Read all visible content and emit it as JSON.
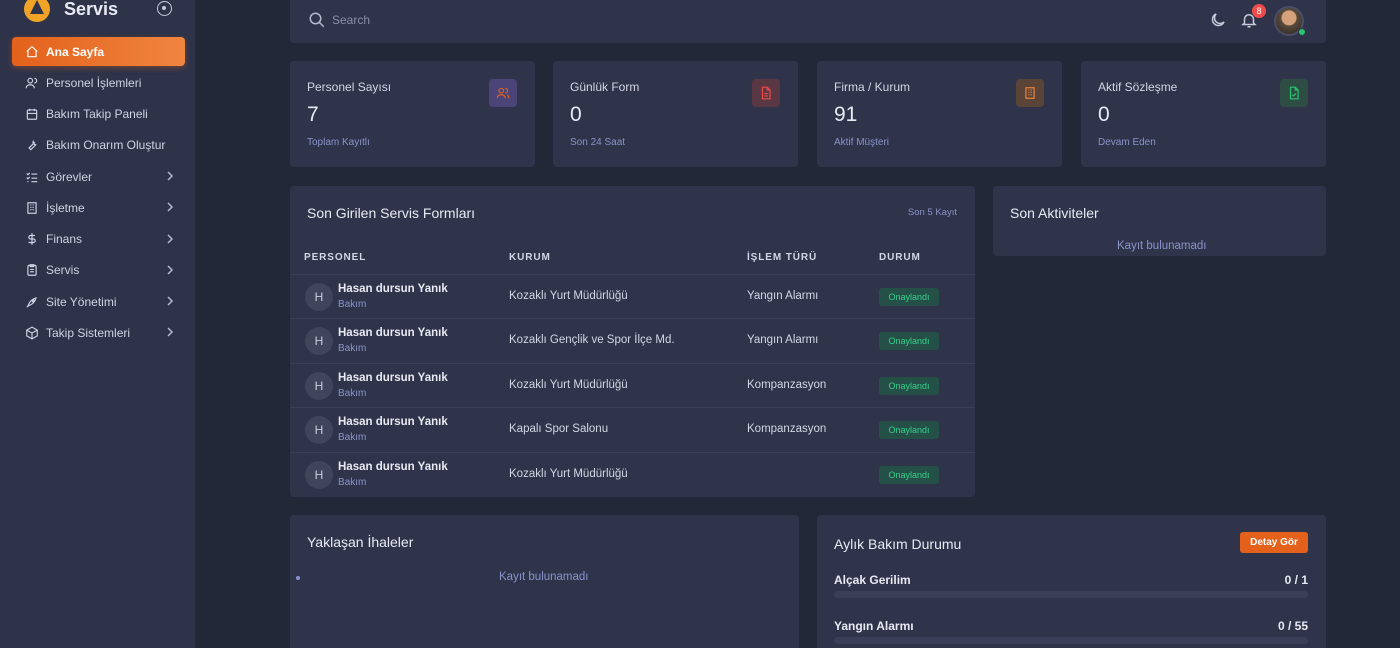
{
  "brand": {
    "name": "Servis"
  },
  "sidebar": {
    "items": [
      {
        "label": "Ana Sayfa",
        "icon": "home-icon",
        "active": true,
        "chevron": false
      },
      {
        "label": "Personel İşlemleri",
        "icon": "users-icon",
        "active": false,
        "chevron": false
      },
      {
        "label": "Bakım Takip Paneli",
        "icon": "calendar-icon",
        "active": false,
        "chevron": false
      },
      {
        "label": "Bakım Onarım Oluştur",
        "icon": "tool-icon",
        "active": false,
        "chevron": false
      },
      {
        "label": "Görevler",
        "icon": "list-check-icon",
        "active": false,
        "chevron": true
      },
      {
        "label": "İşletme",
        "icon": "building-icon",
        "active": false,
        "chevron": true
      },
      {
        "label": "Finans",
        "icon": "dollar-icon",
        "active": false,
        "chevron": true
      },
      {
        "label": "Servis",
        "icon": "clipboard-icon",
        "active": false,
        "chevron": true
      },
      {
        "label": "Site Yönetimi",
        "icon": "rocket-icon",
        "active": false,
        "chevron": true
      },
      {
        "label": "Takip Sistemleri",
        "icon": "box-icon",
        "active": false,
        "chevron": true
      }
    ]
  },
  "header": {
    "search_placeholder": "Search",
    "notification_count": "8"
  },
  "stats": [
    {
      "title": "Personel Sayısı",
      "value": "7",
      "sub": "Toplam Kayıtlı",
      "icon": "users-icon",
      "icon_color": "#e3611b",
      "icon_bg": "#4a4478"
    },
    {
      "title": "Günlük Form",
      "value": "0",
      "sub": "Son 24 Saat",
      "icon": "file-icon",
      "icon_color": "#ef4b4b",
      "icon_bg": "#5a3843"
    },
    {
      "title": "Firma / Kurum",
      "value": "91",
      "sub": "Aktif Müşteri",
      "icon": "building-icon",
      "icon_color": "#f0853f",
      "icon_bg": "#5a4438"
    },
    {
      "title": "Aktif Sözleşme",
      "value": "0",
      "sub": "Devam Eden",
      "icon": "file-check-icon",
      "icon_color": "#28c76f",
      "icon_bg": "#2d4d45"
    }
  ],
  "forms": {
    "title": "Son Girilen Servis Formları",
    "meta": "Son 5 Kayıt",
    "headers": [
      "PERSONEL",
      "KURUM",
      "İŞLEM TÜRÜ",
      "DURUM"
    ],
    "rows": [
      {
        "initial": "H",
        "name": "Hasan dursun Yanık",
        "role": "Bakım",
        "kurum": "Kozaklı Yurt Müdürlüğü",
        "tur": "Yangın Alarmı",
        "durum": "Onaylandı"
      },
      {
        "initial": "H",
        "name": "Hasan dursun Yanık",
        "role": "Bakım",
        "kurum": "Kozaklı Gençlik ve Spor İlçe Md.",
        "tur": "Yangın Alarmı",
        "durum": "Onaylandı"
      },
      {
        "initial": "H",
        "name": "Hasan dursun Yanık",
        "role": "Bakım",
        "kurum": "Kozaklı Yurt Müdürlüğü",
        "tur": "Kompanzasyon",
        "durum": "Onaylandı"
      },
      {
        "initial": "H",
        "name": "Hasan dursun Yanık",
        "role": "Bakım",
        "kurum": "Kapalı Spor Salonu",
        "tur": "Kompanzasyon",
        "durum": "Onaylandı"
      },
      {
        "initial": "H",
        "name": "Hasan dursun Yanık",
        "role": "Bakım",
        "kurum": "Kozaklı Yurt Müdürlüğü",
        "tur": "",
        "durum": "Onaylandı"
      }
    ]
  },
  "activities": {
    "title": "Son Aktiviteler",
    "empty": "Kayıt bulunamadı"
  },
  "tenders": {
    "title": "Yaklaşan İhaleler",
    "empty": "Kayıt bulunamadı"
  },
  "maintenance": {
    "title": "Aylık Bakım Durumu",
    "button": "Detay Gör",
    "items": [
      {
        "label": "Alçak Gerilim",
        "value": "0 / 1",
        "progress": 0
      },
      {
        "label": "Yangın Alarmı",
        "value": "0 / 55",
        "progress": 0
      }
    ]
  },
  "colors": {
    "accent": "#e3611b",
    "success": "#28c76f",
    "danger": "#ef4b4b"
  }
}
